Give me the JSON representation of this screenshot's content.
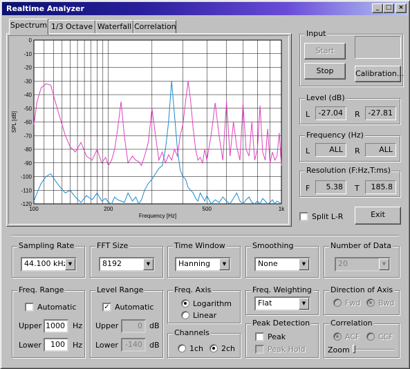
{
  "window": {
    "title": "Realtime Analyzer",
    "min": "_",
    "max": "□",
    "close": "×"
  },
  "tabs": [
    "Spectrum",
    "1/3 Octave",
    "Waterfall",
    "Correlation"
  ],
  "chart_data": {
    "type": "line",
    "xlabel": "Frequency [Hz]",
    "ylabel": "SPL [dB]",
    "xscale": "log",
    "xlim": [
      100,
      1000
    ],
    "ylim": [
      -120,
      0
    ],
    "xticks": [
      "100",
      "200",
      "500",
      "1k"
    ],
    "yticks": [
      "0",
      "-10",
      "-20",
      "-30",
      "-40",
      "-50",
      "-60",
      "-70",
      "-80",
      "-90",
      "-100",
      "-110",
      "-120"
    ],
    "grid": true,
    "series": [
      {
        "color": "#e040c0",
        "x": [
          100,
          103,
          107,
          112,
          117,
          122,
          128,
          134,
          140,
          147,
          155,
          163,
          172,
          180,
          188,
          195,
          200,
          206,
          212,
          218,
          225,
          232,
          240,
          250,
          258,
          265,
          272,
          280,
          290,
          300,
          310,
          320,
          330,
          340,
          350,
          360,
          370,
          380,
          390,
          400,
          410,
          420,
          430,
          440,
          450,
          460,
          470,
          480,
          490,
          500,
          520,
          540,
          560,
          580,
          600,
          620,
          640,
          660,
          680,
          700,
          720,
          740,
          760,
          780,
          800,
          820,
          840,
          860,
          880,
          900,
          920,
          940,
          960,
          980,
          1000
        ],
        "y": [
          -62,
          -45,
          -35,
          -32,
          -33,
          -45,
          -58,
          -70,
          -78,
          -82,
          -75,
          -85,
          -88,
          -80,
          -90,
          -86,
          -92,
          -88,
          -80,
          -65,
          -45,
          -70,
          -90,
          -85,
          -88,
          -89,
          -92,
          -85,
          -75,
          -50,
          -70,
          -88,
          -82,
          -90,
          -84,
          -88,
          -80,
          -85,
          -70,
          -62,
          -45,
          -30,
          -45,
          -65,
          -80,
          -88,
          -86,
          -90,
          -80,
          -88,
          -70,
          -46,
          -70,
          -88,
          -45,
          -85,
          -60,
          -78,
          -88,
          -46,
          -80,
          -85,
          -60,
          -88,
          -80,
          -48,
          -82,
          -88,
          -65,
          -90,
          -82,
          -88,
          -85,
          -68,
          -92
        ]
      },
      {
        "color": "#1a8ad0",
        "x": [
          100,
          103,
          107,
          112,
          117,
          122,
          128,
          134,
          140,
          147,
          155,
          163,
          172,
          180,
          188,
          195,
          200,
          206,
          212,
          218,
          225,
          232,
          240,
          250,
          258,
          265,
          272,
          280,
          290,
          300,
          310,
          320,
          330,
          340,
          350,
          360,
          370,
          380,
          390,
          400,
          410,
          420,
          430,
          440,
          450,
          460,
          470,
          480,
          490,
          500,
          520,
          540,
          560,
          580,
          600,
          620,
          640,
          660,
          680,
          700,
          720,
          740,
          760,
          780,
          800,
          820,
          840,
          860,
          880,
          900,
          920,
          940,
          960,
          980,
          1000
        ],
        "y": [
          -118,
          -112,
          -105,
          -100,
          -98,
          -103,
          -108,
          -112,
          -110,
          -115,
          -119,
          -114,
          -117,
          -112,
          -118,
          -116,
          -119,
          -120,
          -115,
          -117,
          -118,
          -119,
          -112,
          -118,
          -115,
          -120,
          -117,
          -110,
          -105,
          -102,
          -98,
          -94,
          -92,
          -80,
          -60,
          -30,
          -55,
          -80,
          -95,
          -100,
          -102,
          -108,
          -110,
          -112,
          -116,
          -118,
          -112,
          -115,
          -118,
          -114,
          -120,
          -117,
          -119,
          -115,
          -118,
          -120,
          -116,
          -112,
          -118,
          -120,
          -117,
          -115,
          -119,
          -120,
          -118,
          -120,
          -116,
          -118,
          -120,
          -119,
          -117,
          -120,
          -118,
          -119,
          -120
        ]
      }
    ]
  },
  "input": {
    "label": "Input",
    "start": "Start",
    "stop": "Stop",
    "calibration": "Calibration..."
  },
  "level": {
    "label": "Level (dB)",
    "l_label": "L",
    "l_value": "-27.04",
    "r_label": "R",
    "r_value": "-27.81"
  },
  "frequency": {
    "label": "Frequency (Hz)",
    "l_label": "L",
    "l_value": "ALL",
    "r_label": "R",
    "r_value": "ALL"
  },
  "resolution": {
    "label": "Resolution (F:Hz,T:ms)",
    "f_label": "F",
    "f_value": "5.38",
    "t_label": "T",
    "t_value": "185.8"
  },
  "split_lr": "Split L-R",
  "exit": "Exit",
  "sampling_rate": {
    "label": "Sampling Rate",
    "value": "44.100 kHz"
  },
  "fft_size": {
    "label": "FFT Size",
    "value": "8192"
  },
  "time_window": {
    "label": "Time Window",
    "value": "Hanning"
  },
  "smoothing": {
    "label": "Smoothing",
    "value": "None"
  },
  "number_of_data": {
    "label": "Number of Data",
    "value": "20"
  },
  "freq_range": {
    "label": "Freq. Range",
    "automatic": "Automatic",
    "upper_label": "Upper",
    "upper_value": "1000",
    "upper_unit": "Hz",
    "lower_label": "Lower",
    "lower_value": "100",
    "lower_unit": "Hz"
  },
  "level_range": {
    "label": "Level Range",
    "automatic": "Automatic",
    "upper_label": "Upper",
    "upper_value": "0",
    "upper_unit": "dB",
    "lower_label": "Lower",
    "lower_value": "-140",
    "lower_unit": "dB"
  },
  "freq_axis": {
    "label": "Freq. Axis",
    "log": "Logarithm",
    "linear": "Linear"
  },
  "channels": {
    "label": "Channels",
    "ch1": "1ch",
    "ch2": "2ch"
  },
  "freq_weighting": {
    "label": "Freq. Weighting",
    "value": "Flat"
  },
  "peak_detection": {
    "label": "Peak Detection",
    "peak": "Peak",
    "peak_hold": "Peak Hold"
  },
  "direction_of_axis": {
    "label": "Direction of Axis",
    "fwd": "Fwd",
    "bwd": "Bwd"
  },
  "correlation": {
    "label": "Correlation",
    "acf": "ACF",
    "ccf": "CCF",
    "zoom": "Zoom"
  }
}
